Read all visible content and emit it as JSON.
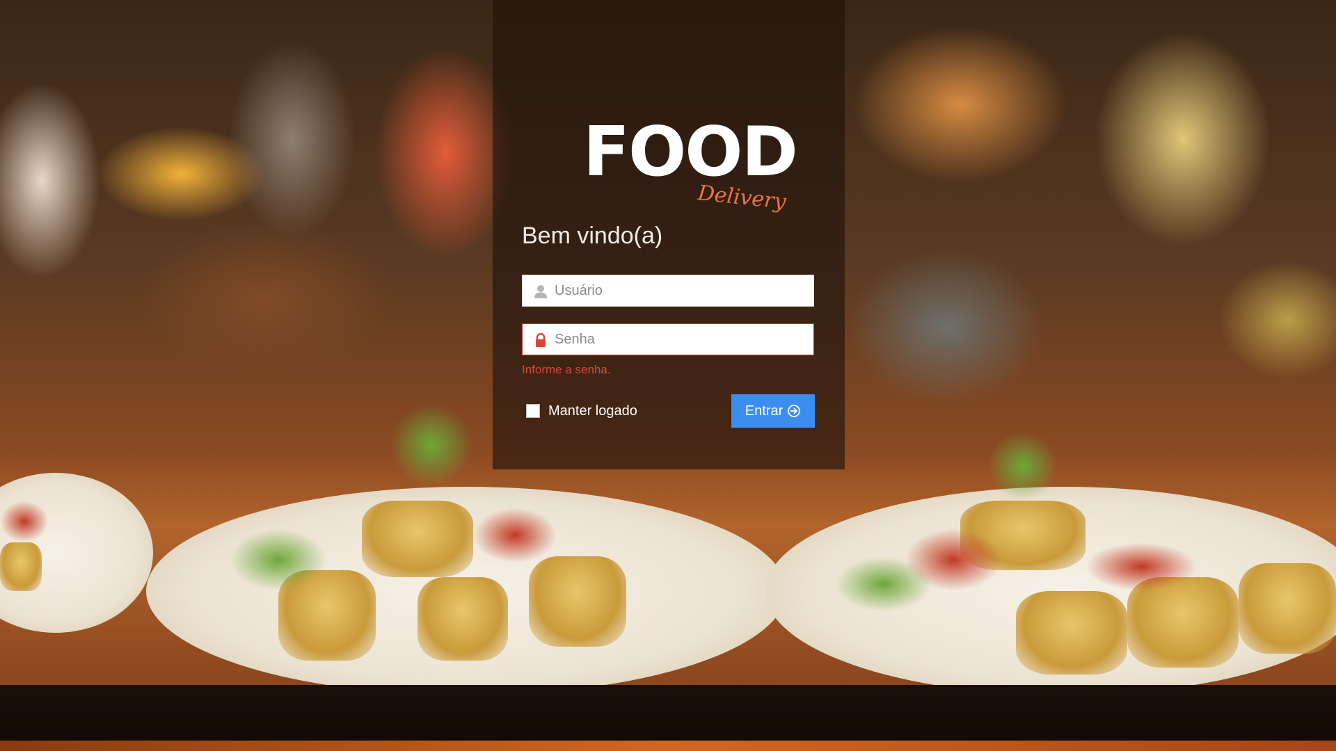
{
  "logo": {
    "main": "FOOD",
    "sub": "Delivery"
  },
  "login": {
    "welcome": "Bem vindo(a)",
    "username": {
      "placeholder": "Usuário",
      "value": "",
      "icon": "user-icon"
    },
    "password": {
      "placeholder": "Senha",
      "value": "",
      "icon": "lock-icon"
    },
    "error": "Informe a senha.",
    "remember_label": "Manter logado",
    "submit_label": "Entrar",
    "submit_icon": "arrow-circle-right-icon"
  },
  "colors": {
    "accent": "#3b8ef0",
    "error": "#d9473a",
    "logo_sub": "#e9744a"
  }
}
